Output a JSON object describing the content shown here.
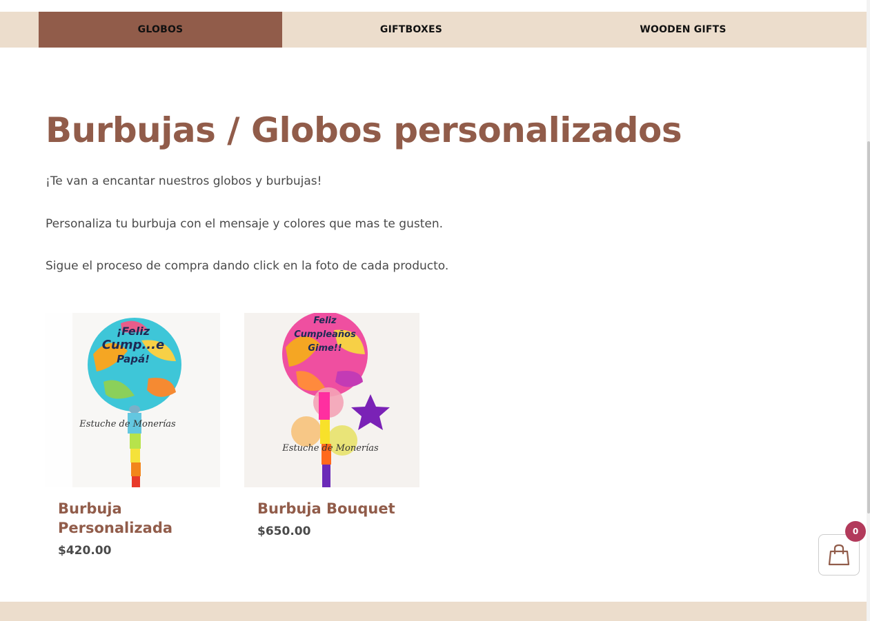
{
  "nav": {
    "items": [
      {
        "label": "GLOBOS",
        "active": true
      },
      {
        "label": "GIFTBOXES",
        "active": false
      },
      {
        "label": "WOODEN GIFTS",
        "active": false
      }
    ]
  },
  "page": {
    "title": "Burbujas / Globos personalizados",
    "paragraphs": [
      "¡Te van a encantar nuestros globos y burbujas!",
      "Personaliza tu burbuja con el mensaje y colores que mas te gusten.",
      "Sigue el proceso de compra dando click en la foto de cada producto."
    ]
  },
  "products": [
    {
      "name": "Burbuja Personalizada",
      "price": "$420.00",
      "image_text": [
        "¡Feliz",
        "Cump...e",
        "Papá!"
      ],
      "watermark": "Estuche de Monerías"
    },
    {
      "name": "Burbuja Bouquet",
      "price": "$650.00",
      "image_text": [
        "Feliz",
        "Cumpleaños",
        "Gime!!"
      ],
      "watermark": "Estuche de Monerías"
    }
  ],
  "cart": {
    "count": "0",
    "icon": "shopping-bag-icon"
  },
  "colors": {
    "brand": "#915c4a",
    "nav_bg": "#ecddcc",
    "badge": "#b23a5b"
  }
}
